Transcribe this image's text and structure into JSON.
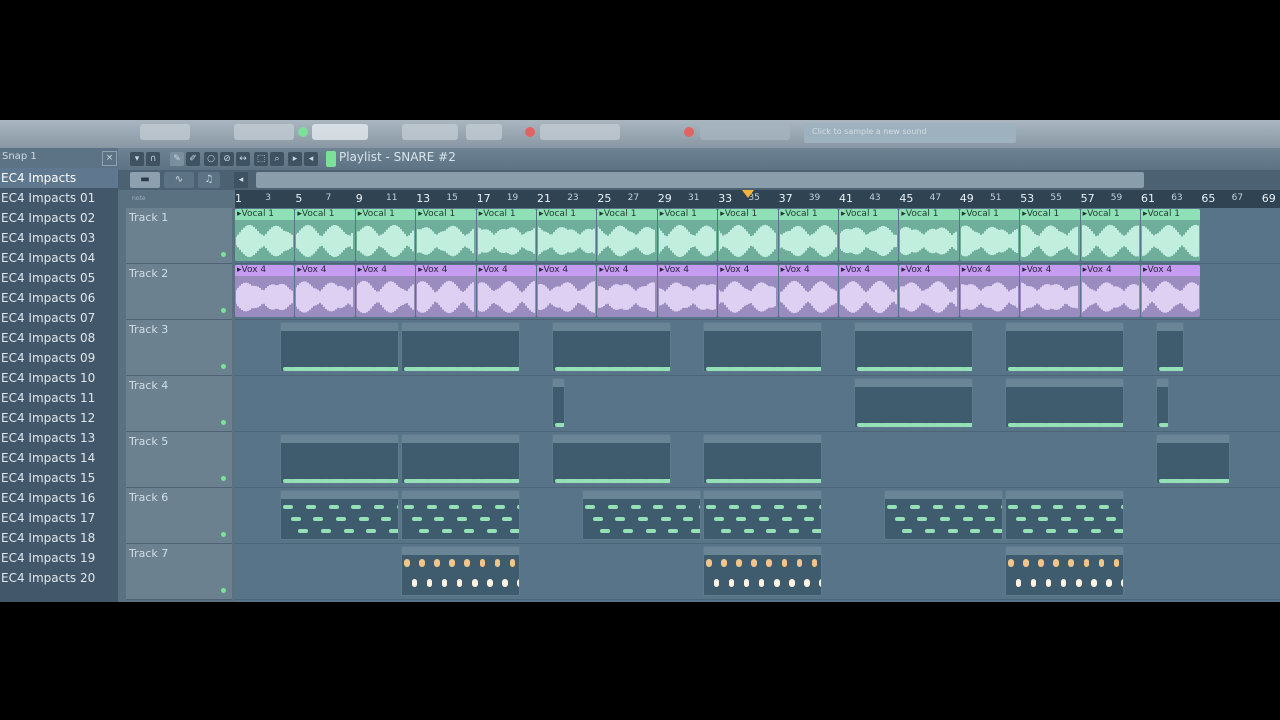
{
  "colors": {
    "vocal_clip": "#8fe0b7",
    "vox_clip": "#c59cf0",
    "pattern_note": "#96e0b8",
    "playhead": "#f3b23a",
    "automation_clip": "#f2c58a"
  },
  "toolbar": {
    "hint_text": "Click to sample a new sound"
  },
  "browser": {
    "snap_label": "Snap 1",
    "close_glyph": "×",
    "items": [
      "EC4 Impacts",
      "EC4 Impacts 01",
      "EC4 Impacts 02",
      "EC4 Impacts 03",
      "EC4 Impacts 04",
      "EC4 Impacts 05",
      "EC4 Impacts 06",
      "EC4 Impacts 07",
      "EC4 Impacts 08",
      "EC4 Impacts 09",
      "EC4 Impacts 10",
      "EC4 Impacts 11",
      "EC4 Impacts 12",
      "EC4 Impacts 13",
      "EC4 Impacts 14",
      "EC4 Impacts 15",
      "EC4 Impacts 16",
      "EC4 Impacts 17",
      "EC4 Impacts 18",
      "EC4 Impacts 19",
      "EC4 Impacts 20"
    ]
  },
  "playlist": {
    "title": "Playlist - SNARE #2",
    "ruler_mini": "note",
    "ruler_numbers": [
      1,
      3,
      5,
      7,
      9,
      11,
      13,
      15,
      17,
      19,
      21,
      23,
      25,
      27,
      29,
      31,
      33,
      35,
      37,
      39,
      41,
      43,
      45,
      47,
      49,
      51,
      53,
      55,
      57,
      59,
      61,
      63,
      65,
      67,
      69
    ],
    "playhead_bar": 35,
    "tracks": [
      {
        "label": "Track 1",
        "clip_name": "Vocal 1",
        "kind": "vocal"
      },
      {
        "label": "Track 2",
        "clip_name": "Vox 4",
        "kind": "vox"
      },
      {
        "label": "Track 3",
        "clip_name": "",
        "kind": "pattern"
      },
      {
        "label": "Track 4",
        "clip_name": "",
        "kind": "pattern"
      },
      {
        "label": "Track 5",
        "clip_name": "",
        "kind": "pattern"
      },
      {
        "label": "Track 6",
        "clip_name": "",
        "kind": "pattern"
      },
      {
        "label": "Track 7",
        "clip_name": "",
        "kind": "pattern"
      }
    ]
  }
}
